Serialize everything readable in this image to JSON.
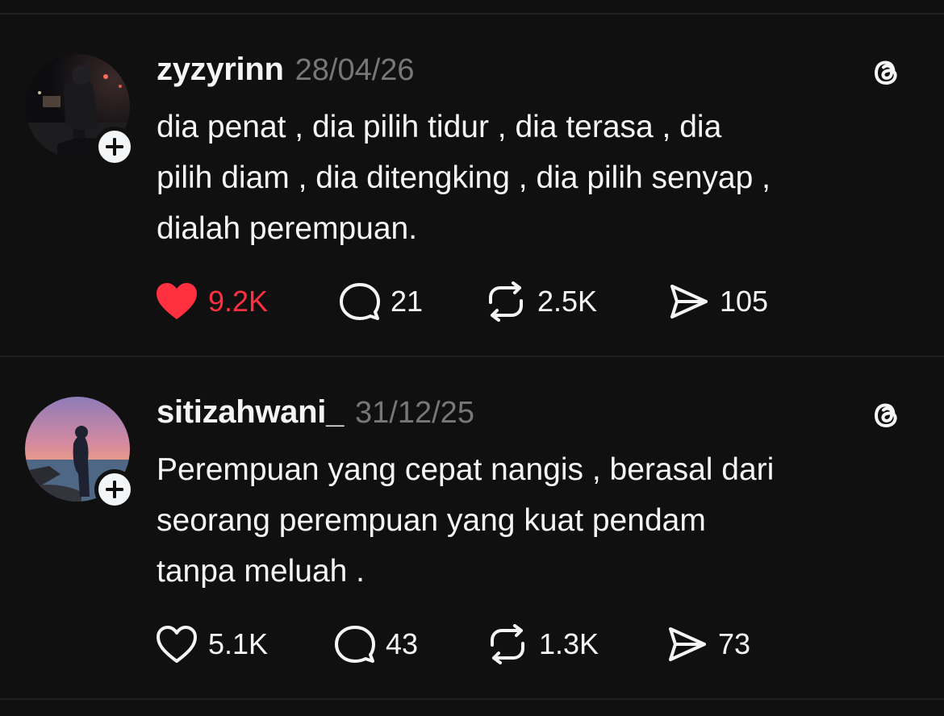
{
  "colors": {
    "background": "#101010",
    "text": "#f3f5f7",
    "muted": "#777777",
    "like_active": "#ff3040",
    "divider": "#202020"
  },
  "posts": [
    {
      "username": "zyzyrinn",
      "date": "28/04/26",
      "text": "dia penat , dia pilih tidur , dia terasa , dia\npilih diam , dia ditengking , dia pilih senyap ,\ndialah perempuan.",
      "liked": true,
      "likes": "9.2K",
      "replies": "21",
      "reposts": "2.5K",
      "shares": "105",
      "icons": {
        "follow": "plus-icon",
        "brand": "threads-logo-icon",
        "like": "heart-filled-icon",
        "reply": "speech-bubble-icon",
        "repost": "repost-icon",
        "share": "send-icon"
      }
    },
    {
      "username": "sitizahwani_",
      "date": "31/12/25",
      "text": "Perempuan yang cepat nangis , berasal dari\nseorang perempuan yang kuat pendam\ntanpa meluah .",
      "liked": false,
      "likes": "5.1K",
      "replies": "43",
      "reposts": "1.3K",
      "shares": "73",
      "icons": {
        "follow": "plus-icon",
        "brand": "threads-logo-icon",
        "like": "heart-outline-icon",
        "reply": "speech-bubble-icon",
        "repost": "repost-icon",
        "share": "send-icon"
      }
    }
  ]
}
